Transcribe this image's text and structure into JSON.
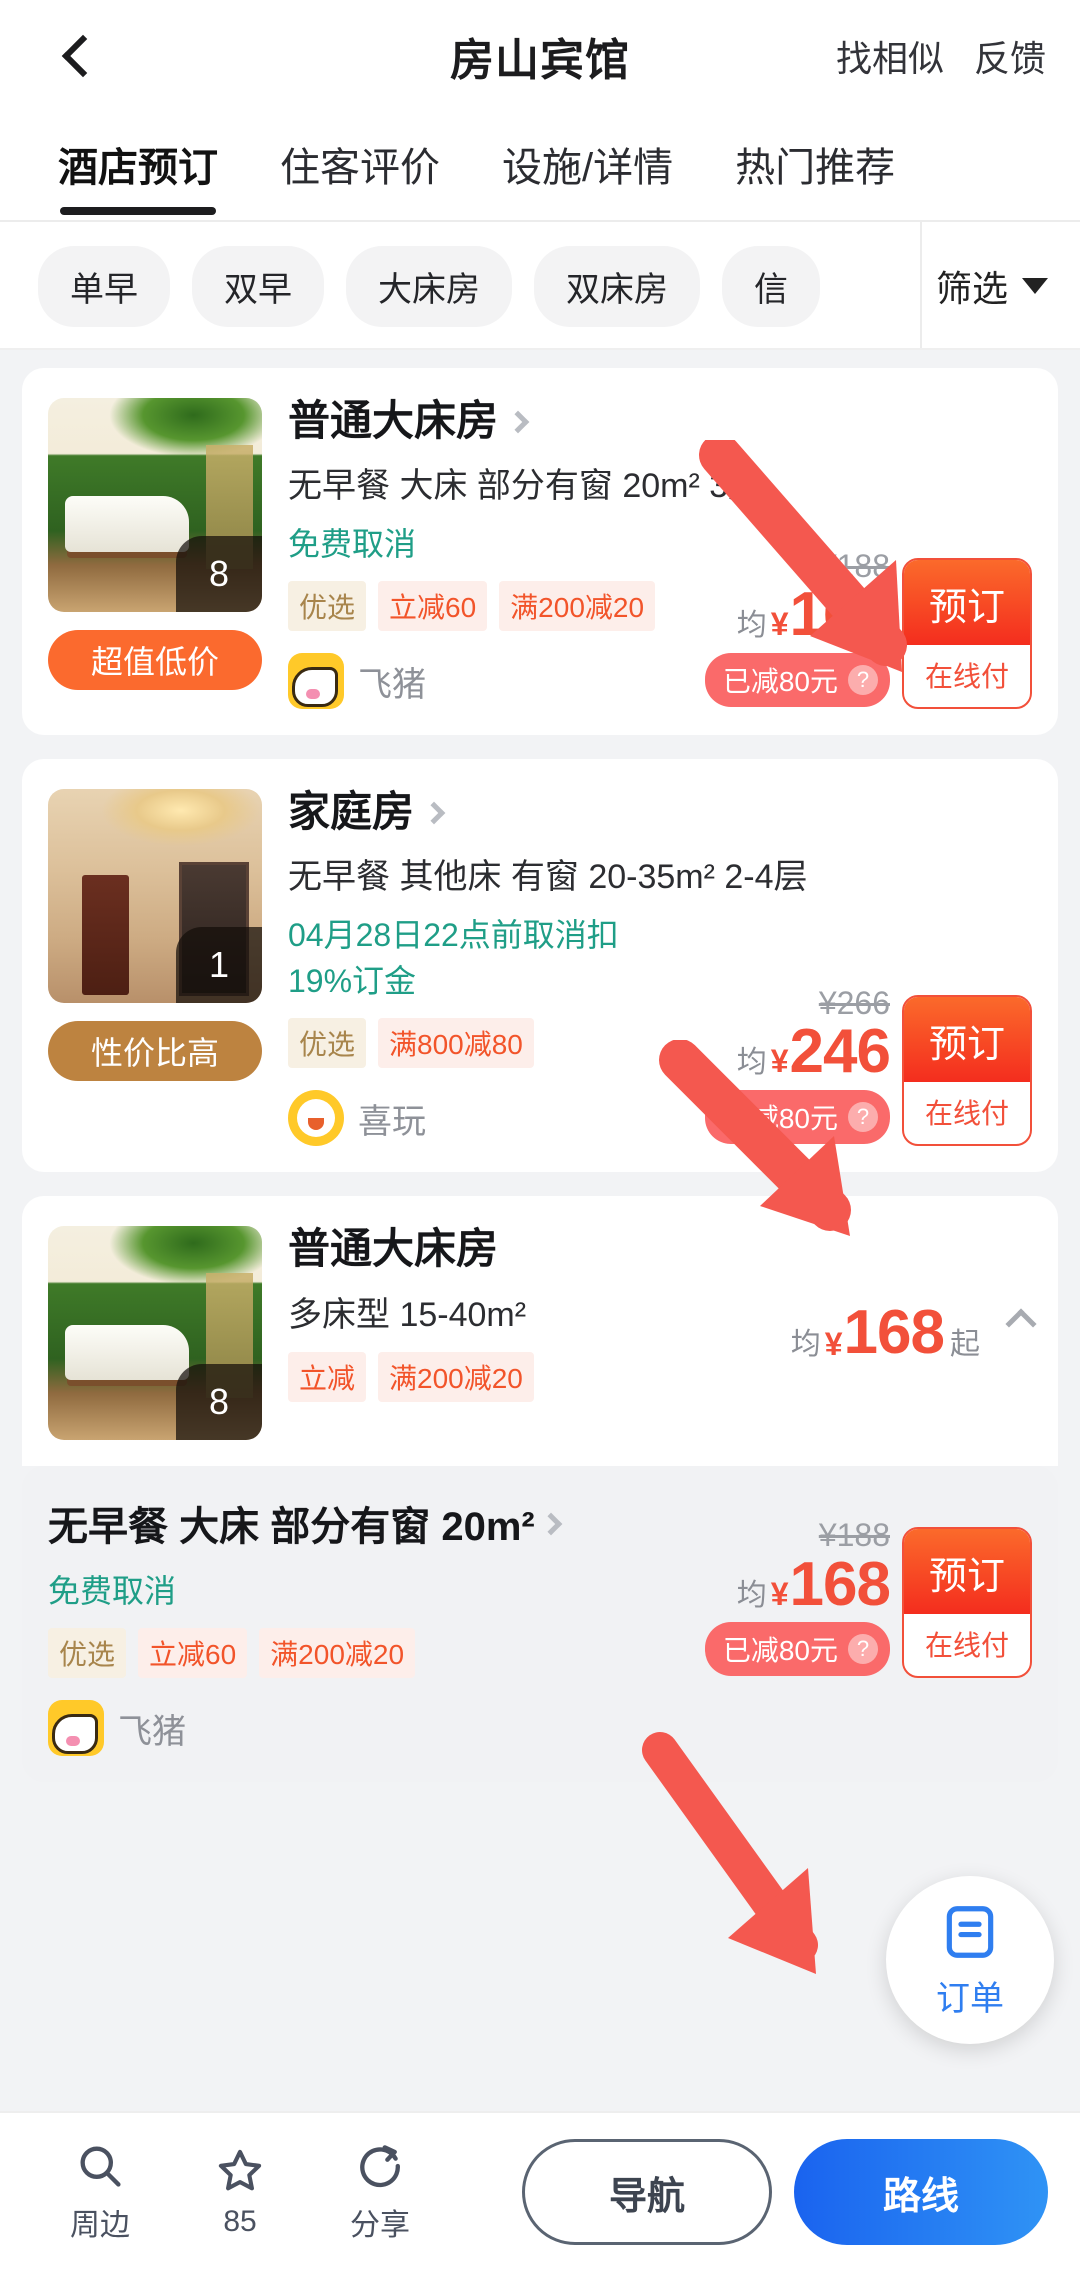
{
  "header": {
    "back_icon": "chevron-left-icon",
    "title": "房山宾馆",
    "actions": [
      "找相似",
      "反馈"
    ]
  },
  "tabs": [
    {
      "label": "酒店预订",
      "active": true
    },
    {
      "label": "住客评价",
      "active": false
    },
    {
      "label": "设施/详情",
      "active": false
    },
    {
      "label": "热门推荐",
      "active": false
    }
  ],
  "filters": {
    "chips": [
      "单早",
      "双早",
      "大床房",
      "双床房",
      "信"
    ],
    "button_label": "筛选",
    "button_icon": "chevron-down-icon"
  },
  "rooms": [
    {
      "title": "普通大床房",
      "meta": "无早餐  大床  部分有窗  20m²  3层",
      "policy": "免费取消",
      "tags": [
        {
          "text": "优选",
          "style": "y"
        },
        {
          "text": "立减60",
          "style": "r"
        },
        {
          "text": "满200减20",
          "style": "r"
        }
      ],
      "photo_count": "8",
      "left_badge": "超值低价",
      "supplier": "飞猪",
      "supplier_icon": "fliggy-pig-icon",
      "old_price": "¥188",
      "price_prefix": "均",
      "currency": "¥",
      "price": "168",
      "saved": "已减80元",
      "saved_help_icon": "question-mark-icon",
      "book_label": "预订",
      "pay_label": "在线付"
    },
    {
      "title": "家庭房",
      "meta": "无早餐  其他床  有窗  20-35m²  2-4层",
      "policy": "04月28日22点前取消扣19%订金",
      "tags": [
        {
          "text": "优选",
          "style": "y"
        },
        {
          "text": "满800减80",
          "style": "r"
        }
      ],
      "photo_count": "1",
      "left_badge": "性价比高",
      "supplier": "喜玩",
      "supplier_icon": "xiwan-monkey-icon",
      "old_price": "¥266",
      "price_prefix": "均",
      "currency": "¥",
      "price": "246",
      "saved": "已减80元",
      "saved_help_icon": "question-mark-icon",
      "book_label": "预订",
      "pay_label": "在线付"
    }
  ],
  "group_room": {
    "title": "普通大床房",
    "meta": "多床型  15-40m²",
    "tags": [
      {
        "text": "立减",
        "style": "r"
      },
      {
        "text": "满200减20",
        "style": "r"
      }
    ],
    "photo_count": "8",
    "price_prefix": "均",
    "currency": "¥",
    "price": "168",
    "price_suffix": "起",
    "collapse_icon": "chevron-up-icon"
  },
  "sub_room": {
    "title": "无早餐 大床 部分有窗 20m²",
    "chevron_icon": "chevron-right-icon",
    "policy": "免费取消",
    "tags": [
      {
        "text": "优选",
        "style": "y"
      },
      {
        "text": "立减60",
        "style": "r"
      },
      {
        "text": "满200减20",
        "style": "r"
      }
    ],
    "supplier": "飞猪",
    "supplier_icon": "fliggy-pig-icon",
    "old_price": "¥188",
    "price_prefix": "均",
    "currency": "¥",
    "price": "168",
    "saved": "已减80元",
    "book_label": "预订",
    "pay_label": "在线付"
  },
  "fab": {
    "icon": "order-document-icon",
    "label": "订单"
  },
  "bottom_bar": {
    "items": [
      {
        "icon": "search-icon",
        "label": "周边"
      },
      {
        "icon": "star-icon",
        "label": "85"
      },
      {
        "icon": "share-icon",
        "label": "分享"
      }
    ],
    "nav_label": "导航",
    "route_label": "路线"
  },
  "colors": {
    "accent_red": "#f2503a",
    "brand_blue": "#1a63ef",
    "policy_green": "#1f9e87",
    "arrow_red": "#f4584f"
  }
}
